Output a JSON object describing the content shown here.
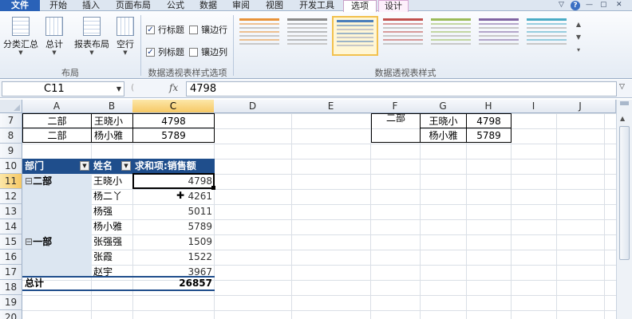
{
  "ribbon_tabs": [
    "文件",
    "开始",
    "插入",
    "页面布局",
    "公式",
    "数据",
    "审阅",
    "视图",
    "开发工具",
    "选项",
    "设计"
  ],
  "window_controls": [
    "▽",
    "—",
    "▢",
    "✕"
  ],
  "help_label": "?",
  "ribbon": {
    "layout_group": {
      "buttons": [
        "分类汇总",
        "总计",
        "报表布局",
        "空行"
      ],
      "label": "布局"
    },
    "style_options_group": {
      "row_headers": "行标题",
      "banded_rows": "镶边行",
      "col_headers": "列标题",
      "banded_cols": "镶边列",
      "label": "数据透视表样式选项",
      "row_headers_checked": true,
      "col_headers_checked": true,
      "banded_rows_checked": false,
      "banded_cols_checked": false
    },
    "styles_group": {
      "label": "数据透视表样式",
      "swatch_colors": [
        "#e8933a",
        "#8a8a8a",
        "#4a7ebb",
        "#c0504d",
        "#9bbb59",
        "#8064a2",
        "#4bacc6"
      ],
      "selected_index": 2
    }
  },
  "formula_bar": {
    "name_box": "C11",
    "fx_label": "fx",
    "value": "4798"
  },
  "columns": [
    "A",
    "B",
    "C",
    "D",
    "E",
    "F",
    "G",
    "H",
    "I",
    "J"
  ],
  "selected_column": "C",
  "rows": [
    "7",
    "8",
    "9",
    "10",
    "11",
    "12",
    "13",
    "14",
    "15",
    "16",
    "17",
    "18",
    "19",
    "20"
  ],
  "selected_row": "11",
  "top_table": [
    {
      "dept": "二部",
      "name": "王晓小",
      "value": "4798"
    },
    {
      "dept": "二部",
      "name": "杨小雅",
      "value": "5789"
    }
  ],
  "right_table": {
    "f_cell": "二部",
    "rows": [
      {
        "name": "王晓小",
        "value": "4798"
      },
      {
        "name": "杨小雅",
        "value": "5789"
      }
    ]
  },
  "pivot": {
    "headers": [
      "部门",
      "姓名",
      "求和项:销售额"
    ],
    "groups": [
      {
        "dept": "二部",
        "collapse": "⊟"
      },
      {
        "dept": "一部",
        "collapse": "⊟"
      }
    ],
    "rows": [
      {
        "name": "王晓小",
        "value": "4798"
      },
      {
        "name": "杨二丫",
        "value": "4261"
      },
      {
        "name": "杨强",
        "value": "5011"
      },
      {
        "name": "杨小雅",
        "value": "5789"
      },
      {
        "name": "张强强",
        "value": "1509"
      },
      {
        "name": "张霞",
        "value": "1522"
      },
      {
        "name": "赵宇",
        "value": "3967"
      }
    ],
    "total_label": "总计",
    "total_value": "26857"
  }
}
